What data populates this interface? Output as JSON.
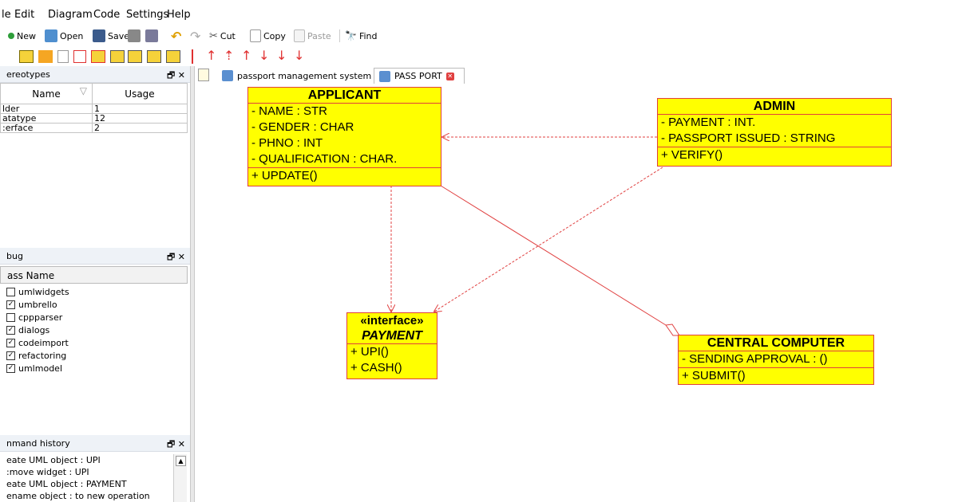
{
  "menubar": {
    "items": [
      "le",
      "Edit",
      "Diagram",
      "Code",
      "Settings",
      "Help"
    ]
  },
  "toolbar": {
    "new": "New",
    "open": "Open",
    "save": "Save",
    "cut": "Cut",
    "copy": "Copy",
    "paste": "Paste",
    "find": "Find"
  },
  "stereotypes": {
    "title": "ereotypes",
    "col_name": "Name",
    "col_usage": "Usage",
    "rows": [
      {
        "name": "lder",
        "usage": "1"
      },
      {
        "name": "atatype",
        "usage": "12"
      },
      {
        "name": ":erface",
        "usage": "2"
      }
    ]
  },
  "debug": {
    "title": "bug",
    "col": "ass Name",
    "items": [
      {
        "label": "umlwidgets",
        "checked": false
      },
      {
        "label": "umbrello",
        "checked": true
      },
      {
        "label": "cppparser",
        "checked": false
      },
      {
        "label": "dialogs",
        "checked": true
      },
      {
        "label": "codeimport",
        "checked": true
      },
      {
        "label": "refactoring",
        "checked": true
      },
      {
        "label": "umlmodel",
        "checked": true
      }
    ]
  },
  "history": {
    "title": "nmand history",
    "lines": [
      "eate UML object : UPI",
      ":move widget : UPI",
      "eate UML object : PAYMENT",
      "ename object : to new operation"
    ]
  },
  "tabs": [
    "passport management system",
    "PASS PORT"
  ],
  "diagram": {
    "applicant": {
      "name": "APPLICANT",
      "attrs": [
        "- NAME : STR",
        "- GENDER : CHAR",
        "- PHNO : INT",
        "- QUALIFICATION : CHAR."
      ],
      "ops": [
        "+ UPDATE()"
      ]
    },
    "admin": {
      "name": "ADMIN",
      "attrs": [
        "- PAYMENT : INT.",
        "- PASSPORT ISSUED : STRING"
      ],
      "ops": [
        "+ VERIFY()"
      ]
    },
    "payment": {
      "stereotype": "«interface»",
      "name": "PAYMENT",
      "ops": [
        "+ UPI()",
        "+ CASH()"
      ]
    },
    "central": {
      "name": "CENTRAL COMPUTER",
      "attrs": [
        "- SENDING APPROVAL : ()"
      ],
      "ops": [
        "+ SUBMIT()"
      ]
    }
  },
  "colors": {
    "class_fill": "#ffff00",
    "class_border": "#e0403a",
    "relation": "#e04040"
  }
}
